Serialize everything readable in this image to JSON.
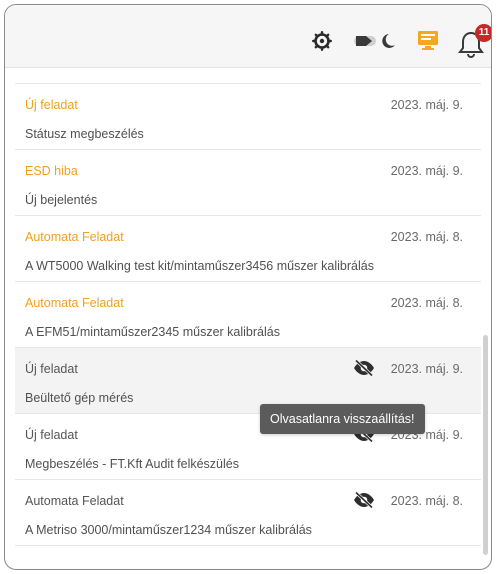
{
  "header": {
    "icons": {
      "settings": "gear-icon",
      "theme": "moon-icon",
      "display": "screen-icon",
      "notifications": "bell-icon"
    },
    "notification_count": "11"
  },
  "notifications": [
    {
      "title": "Új feladat",
      "date": "2023. máj. 9.",
      "body": "Státusz megbeszélés",
      "read": false,
      "show_eye": false
    },
    {
      "title": "ESD hiba",
      "date": "2023. máj. 9.",
      "body": "Új bejelentés",
      "read": false,
      "show_eye": false
    },
    {
      "title": "Automata Feladat",
      "date": "2023. máj. 8.",
      "body": "A WT5000 Walking test kit/mintaműszer3456 műszer kalibrálás",
      "read": false,
      "show_eye": false
    },
    {
      "title": "Automata Feladat",
      "date": "2023. máj. 8.",
      "body": "A EFM51/mintaműszer2345 műszer kalibrálás",
      "read": false,
      "show_eye": false
    },
    {
      "title": "Új feladat",
      "date": "2023. máj. 9.",
      "body": "Beültető gép mérés",
      "read": true,
      "show_eye": true
    },
    {
      "title": "Új feladat",
      "date": "2023. máj. 9.",
      "body": "Megbeszélés - FT.Kft Audit felkészülés",
      "read": true,
      "show_eye": true
    },
    {
      "title": "Automata Feladat",
      "date": "2023. máj. 8.",
      "body": "A Metriso 3000/mintaműszer1234 műszer kalibrálás",
      "read": true,
      "show_eye": true
    }
  ],
  "tooltip": {
    "text": "Olvasatlanra visszaállítás!"
  },
  "colors": {
    "unread_title": "#f0a020",
    "read_title": "#555555",
    "badge": "#c62828",
    "tooltip_bg": "#5b5b5b"
  }
}
